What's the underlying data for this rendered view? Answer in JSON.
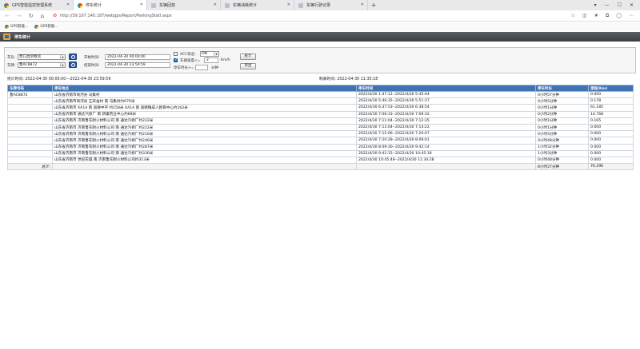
{
  "browser": {
    "tabs": [
      {
        "label": "GPS智能监控管理系统",
        "active": false,
        "fav": "green"
      },
      {
        "label": "停车统计",
        "active": true,
        "fav": "green"
      },
      {
        "label": "车辆回放",
        "active": false,
        "fav": "doc"
      },
      {
        "label": "车辆油耗统计",
        "active": false,
        "fav": "doc"
      },
      {
        "label": "车辆行驶记录",
        "active": false,
        "fav": "doc"
      }
    ],
    "url": "http://39.107.140.187/webgps/Report/ParkingStatI.aspx",
    "bookmarks": [
      "GPS智能...",
      "GPS智能..."
    ]
  },
  "page": {
    "title": "停车统计"
  },
  "filter": {
    "team_label": "车队:",
    "team_value": "营口昌凯物流",
    "vehicle_label": "车牌:",
    "vehicle_value": "鲁AC8872",
    "start_label": "开始时间:",
    "start_value": "2022-04-30 00:00:00",
    "end_label": "结束时间:",
    "end_value": "2022-04-30 23:59:59",
    "acc_label": "ACC状态:",
    "acc_value": "ON",
    "speed_label": "车辆速度<=",
    "speed_value": "2",
    "speed_unit": "Km/h",
    "park_label": "停车时长>=",
    "park_value": "",
    "park_unit": "分钟",
    "stat_button": "统计",
    "export_button": "导出"
  },
  "info": {
    "range": "统计时间:   2022-04-30 00:00:00---2022-04-30 23:59:59",
    "made": "制表时间:   2022-04-30 11:35:18"
  },
  "table": {
    "headers": [
      "车牌号码",
      "停车地点",
      "停车时间",
      "停车时长",
      "里程(Km)"
    ],
    "plate": "鲁AC8872",
    "rows": [
      {
        "place": "山东省济南市商河县 马集村",
        "time": "2022/4/30 1:47:12--2022/4/30 5:45:04",
        "dur": "0小时57分钟",
        "km": "0.000"
      },
      {
        "place": "山东省济南市商河县 王宋舍村 南 马集村约679米",
        "time": "2022/4/30 5:46:35--2022/4/30 5:51:37",
        "dur": "0小时5分钟",
        "km": "0.178"
      },
      {
        "place": "山东省济南市 XA14 南 道德中学 约158米 XA14 南 道德镇成人教育中心约162米",
        "time": "2022/4/30 6:37:53--2022/4/30 6:38:54",
        "dur": "0小时1分钟",
        "km": "61.185"
      },
      {
        "place": "山东省济南市 通达汽修厂 南 新康药业中心约68米",
        "time": "2022/4/30 7:06:33--2022/4/30 7:09:32",
        "dur": "0小时2分钟",
        "km": "14.768"
      },
      {
        "place": "山东省济南市 济南鲁东耐火材料公司 南 通达汽修厂约222米",
        "time": "2022/4/30 7:11:04--2022/4/30 7:12:35",
        "dur": "0小时1分钟",
        "km": "0.165"
      },
      {
        "place": "山东省济南市 济南鲁东耐火材料公司 南 通达汽修厂约222米",
        "time": "2022/4/30 7:13:04--2022/4/30 7:14:22",
        "dur": "0小时1分钟",
        "km": "0.000"
      },
      {
        "place": "山东省济南市 济南鲁东耐火材料公司 南 通达汽修厂约216米",
        "time": "2022/4/30 7:15:06--2022/4/30 7:20:07",
        "dur": "0小时5分钟",
        "km": "0.000"
      },
      {
        "place": "山东省济南市 济南鲁东耐火材料公司 南 通达汽修厂约246米",
        "time": "2022/4/30 7:20:28--2022/4/30 8:09:01",
        "dur": "0小时48分钟",
        "km": "0.000"
      },
      {
        "place": "山东省济南市 济南鲁东耐火材料公司 南 通达汽修厂约287米",
        "time": "2022/4/30 8:09:30--2022/4/30 9:42:14",
        "dur": "1小时32分钟",
        "km": "0.000"
      },
      {
        "place": "山东省济南市 济南鲁东耐火材料公司 南 通达汽修厂约336米",
        "time": "2022/4/30 9:42:15--2022/4/30 10:45:18",
        "dur": "1小时3分钟",
        "km": "0.000"
      },
      {
        "place": "山东省济南市 世纪花城 南 济南鲁东耐火材料公司约313米",
        "time": "2022/4/30 10:45:48--2022/4/30 11:34:28",
        "dur": "0小时48分钟",
        "km": "0.000"
      }
    ],
    "total_label": "总计:",
    "total_dur": "8小时27分钟",
    "total_km": "76.296"
  }
}
